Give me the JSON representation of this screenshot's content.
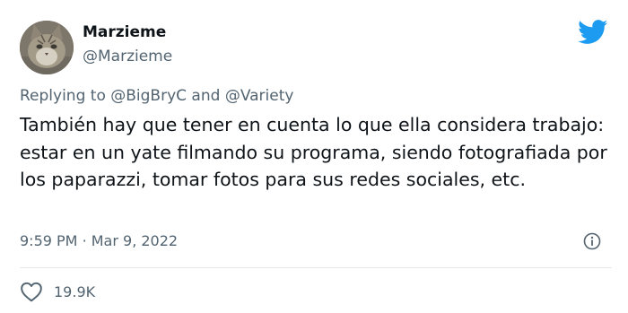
{
  "author": {
    "name": "Marzieme",
    "handle": "@Marzieme"
  },
  "reply": {
    "prefix": "Replying to",
    "mention1": "@BigBryC",
    "and": "and",
    "mention2": "@Variety"
  },
  "tweet": {
    "text": "También hay que tener en cuenta lo que ella considera trabajo: estar en un yate filmando su programa, siendo fotografiada por los paparazzi, tomar fotos para sus redes sociales, etc."
  },
  "meta": {
    "time": "9:59 PM",
    "separator": "·",
    "date": "Mar 9, 2022"
  },
  "stats": {
    "likes": "19.9K"
  },
  "colors": {
    "brand": "#1d9bf0",
    "text": "#0f1419",
    "secondary": "#536471",
    "divider": "#e4e8eb"
  },
  "icons": {
    "logo": "twitter-bird-icon",
    "info": "info-icon",
    "like": "heart-icon"
  }
}
